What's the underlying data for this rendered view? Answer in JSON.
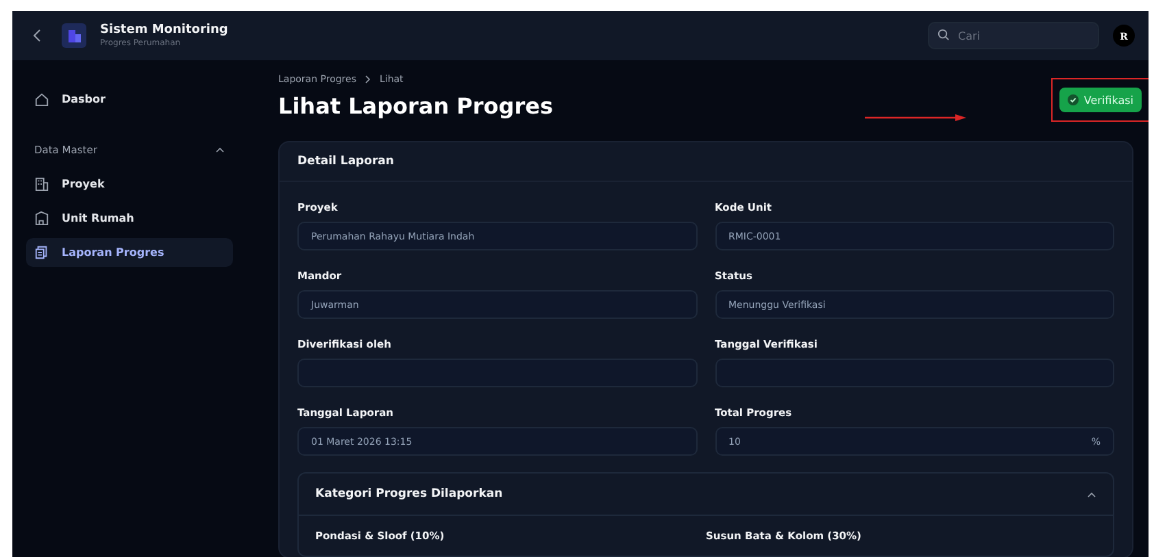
{
  "header": {
    "app_title": "Sistem Monitoring",
    "app_subtitle": "Progres Perumahan",
    "search": {
      "placeholder": "Cari"
    },
    "avatar": "R"
  },
  "sidebar": {
    "items": [
      {
        "label": "Dasbor",
        "kind": "home",
        "selected": false
      }
    ],
    "sections": [
      {
        "title": "Data Master",
        "expanded": true,
        "items": [
          {
            "label": "Proyek",
            "kind": "building",
            "selected": false
          },
          {
            "label": "Unit Rumah",
            "kind": "house",
            "selected": false
          },
          {
            "label": "Laporan Progres",
            "kind": "report",
            "selected": true
          }
        ]
      }
    ]
  },
  "breadcrumb": [
    "Laporan Progres",
    "Lihat"
  ],
  "page_title": "Lihat Laporan Progres",
  "verify_button": {
    "label": "Verifikasi",
    "highlighted": true
  },
  "card": {
    "title": "Detail Laporan",
    "fields": [
      {
        "label": "Proyek",
        "value": "Perumahan Rahayu Mutiara Indah"
      },
      {
        "label": "Kode Unit",
        "value": "RMIC-0001"
      },
      {
        "label": "Mandor",
        "value": "Juwarman"
      },
      {
        "label": "Status",
        "value": "Menunggu Verifikasi"
      },
      {
        "label": "Diverifikasi oleh"
      },
      {
        "label": "Tanggal Verifikasi"
      },
      {
        "label": "Tanggal Laporan",
        "value": "01 Maret 2026 13:15"
      },
      {
        "label": "Total Progres",
        "value": "10",
        "suffix": "%"
      }
    ],
    "categories": {
      "title": "Kategori Progres Dilaporkan",
      "expanded": true,
      "items": [
        "Pondasi & Sloof (10%)",
        "Susun Bata & Kolom (30%)"
      ]
    }
  }
}
